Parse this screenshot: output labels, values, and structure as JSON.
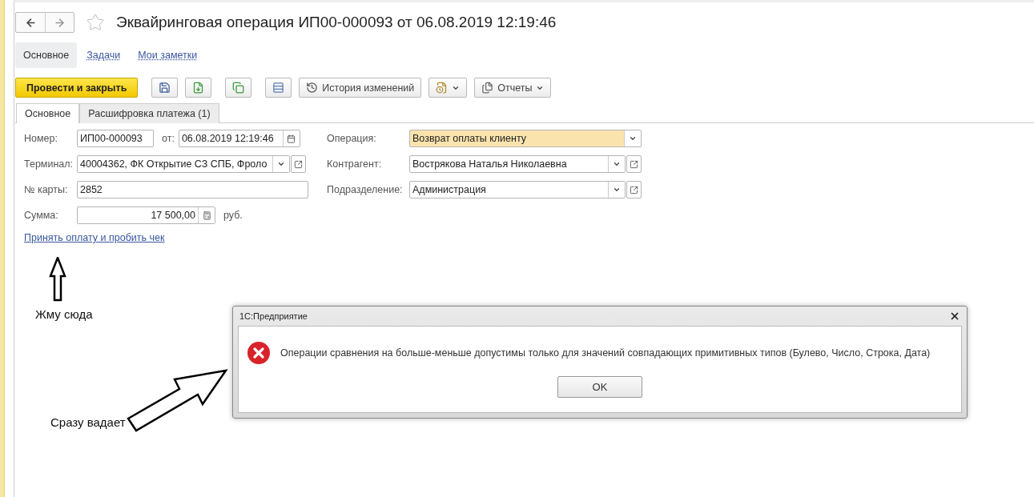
{
  "window": {
    "title": "Эквайринговая операция ИП00-000093 от 06.08.2019 12:19:46",
    "favorite": false
  },
  "section_tabs": [
    {
      "label": "Основное",
      "selected": true
    },
    {
      "label": "Задачи",
      "selected": false
    },
    {
      "label": "Мои заметки",
      "selected": false
    }
  ],
  "toolbar": [
    {
      "kind": "primary",
      "label": "Провести и закрыть"
    },
    {
      "kind": "save"
    },
    {
      "kind": "post"
    },
    {
      "kind": "copy"
    },
    {
      "kind": "list"
    },
    {
      "kind": "history",
      "label": "История изменений"
    },
    {
      "kind": "attach-menu"
    },
    {
      "kind": "reports",
      "label": "Отчеты"
    }
  ],
  "form_tabs": [
    {
      "label": "Основное",
      "selected": true
    },
    {
      "label": "Расшифровка платежа (1)",
      "selected": false
    }
  ],
  "rows": [
    {
      "left": [
        {
          "kind": "text",
          "label": "Номер:",
          "value": "ИП00-000093"
        },
        {
          "kind": "date",
          "label": "от:",
          "value": "06.08.2019 12:19:46"
        }
      ],
      "right": {
        "kind": "select",
        "label": "Операция:",
        "value": "Возврат оплаты клиенту",
        "highlighted": true,
        "open_button": false
      }
    },
    {
      "left": [
        {
          "kind": "select",
          "label": "Терминал:",
          "value": "40004362, ФК Открытие СЗ СПБ, Фроло",
          "open_button": true
        }
      ],
      "right": {
        "kind": "select",
        "label": "Контрагент:",
        "value": "Вострякова Наталья Николаевна",
        "highlighted": false,
        "open_button": true
      }
    },
    {
      "left": [
        {
          "kind": "text",
          "label": "№ карты:",
          "value": "2852",
          "wide": true
        }
      ],
      "right": {
        "kind": "select",
        "label": "Подразделение:",
        "value": "Администрация",
        "highlighted": false,
        "open_button": true
      }
    },
    {
      "left": [
        {
          "kind": "number",
          "label": "Сумма:",
          "value": "17 500,00",
          "unit": "руб."
        }
      ]
    }
  ],
  "link": "Принять оплату и пробить чек",
  "annotations": [
    {
      "kind": "up",
      "text": "Жму сюда"
    },
    {
      "kind": "diagonal",
      "text": "Сразу вадает"
    }
  ],
  "dialog": {
    "title": "1С:Предприятие",
    "message": "Операции сравнения на больше-меньше допустимы только для значений совпадающих примитивных типов (Булево, Число, Строка, Дата)",
    "button": "OK"
  }
}
